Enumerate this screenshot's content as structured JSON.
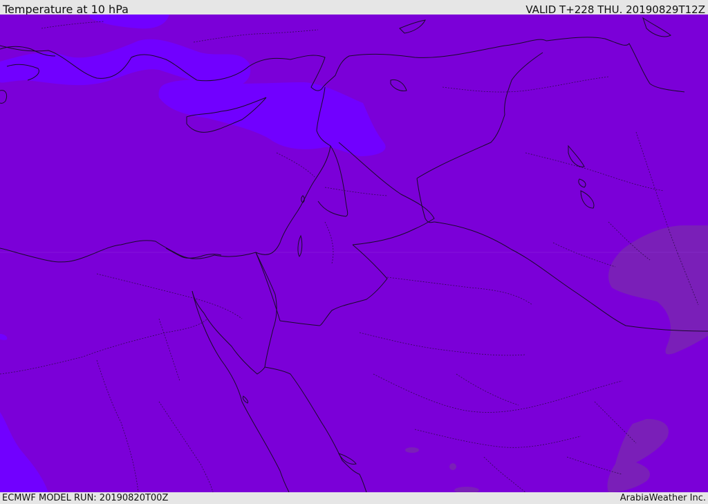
{
  "header": {
    "title": "Temperature at 10 hPa",
    "valid_time": "VALID T+228 THU. 20190829T12Z"
  },
  "footer": {
    "model_run": "ECMWF MODEL RUN: 20190820T00Z",
    "credit": "ArabiaWeather Inc."
  },
  "map": {
    "colors": {
      "base_fill": "#7b00d8",
      "warmer_fill": "#7a1fb8",
      "cooler_fill": "#7100ff",
      "coastline": "#1a0a2a",
      "borders": "#1a0a2a"
    }
  }
}
